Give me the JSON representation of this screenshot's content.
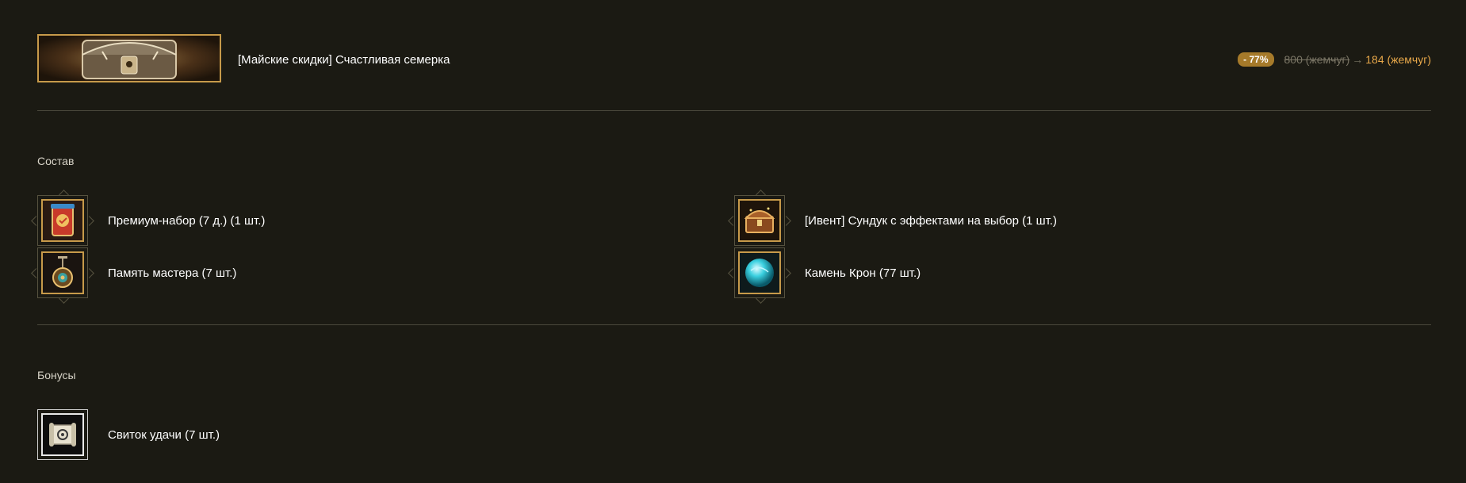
{
  "product": {
    "title": "[Майские скидки] Счастливая семерка",
    "discount_badge": "- 77%",
    "old_price": "800 (жемчуг)",
    "arrow": "→",
    "new_price": "184 (жемчуг)",
    "banner_icon": "treasure-chest-banner"
  },
  "composition": {
    "title": "Состав",
    "items": [
      {
        "label": "Премиум-набор (7 д.) (1 шт.)",
        "icon": "premium-pack-icon"
      },
      {
        "label": "[Ивент] Сундук с эффектами на выбор (1 шт.)",
        "icon": "chest-icon"
      },
      {
        "label": "Память мастера (7 шт.)",
        "icon": "master-memory-icon"
      },
      {
        "label": "Камень Крон (77 шт.)",
        "icon": "crystal-orb-icon"
      }
    ]
  },
  "bonuses": {
    "title": "Бонусы",
    "items": [
      {
        "label": "Свиток удачи (7 шт.)",
        "icon": "scroll-icon"
      }
    ]
  },
  "colors": {
    "background": "#1b1a13",
    "accent_gold": "#c79a4a",
    "badge": "#a67a2a",
    "new_price": "#e8a84a",
    "old_price": "#7a7565"
  }
}
